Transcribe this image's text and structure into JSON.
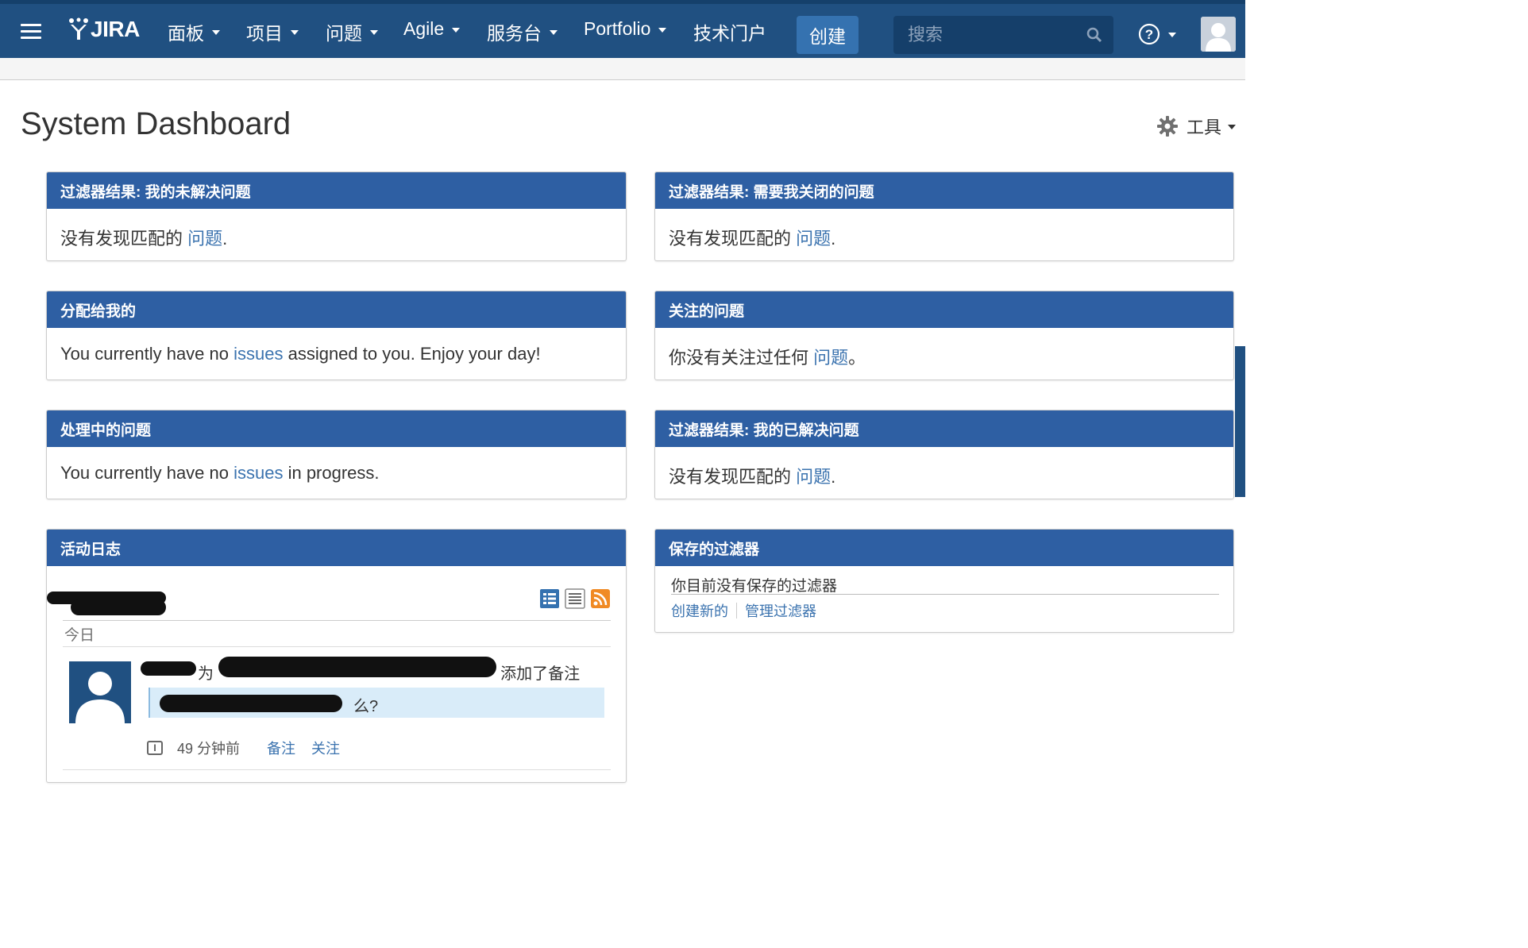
{
  "nav": {
    "logo_text": "JIRA",
    "items": [
      {
        "label": "面板"
      },
      {
        "label": "项目"
      },
      {
        "label": "问题"
      },
      {
        "label": "Agile"
      },
      {
        "label": "服务台"
      },
      {
        "label": "Portfolio"
      },
      {
        "label": "技术门户"
      }
    ],
    "create_label": "创建",
    "search_placeholder": "搜索",
    "colors": {
      "bar": "#205081",
      "create": "#3572b0",
      "search_bg": "#153f6a"
    }
  },
  "page": {
    "title": "System Dashboard",
    "tools_label": "工具"
  },
  "gadgets": {
    "unresolved": {
      "title": "过滤器结果: 我的未解决问题",
      "text": "没有发现匹配的 ",
      "link": "问题",
      "suffix": "."
    },
    "to_close": {
      "title": "过滤器结果: 需要我关闭的问题",
      "text": "没有发现匹配的 ",
      "link": "问题",
      "suffix": "."
    },
    "assigned": {
      "title": "分配给我的",
      "text": "You currently have no ",
      "link": "issues",
      "suffix": " assigned to you. Enjoy your day!"
    },
    "watched": {
      "title": "关注的问题",
      "text": "你没有关注过任何 ",
      "link": "问题",
      "suffix": "。"
    },
    "in_progress": {
      "title": "处理中的问题",
      "text": "You currently have no ",
      "link": "issues",
      "suffix": " in progress."
    },
    "resolved": {
      "title": "过滤器结果: 我的已解决问题",
      "text": "没有发现匹配的 ",
      "link": "问题",
      "suffix": "."
    },
    "activity": {
      "title": "活动日志",
      "today_label": "今日",
      "entry": {
        "verb_for": "为",
        "action": "添加了备注",
        "quote_end": "么?",
        "time": "49 分钟前",
        "comment_link": "备注",
        "watch_link": "关注"
      }
    },
    "saved_filters": {
      "title": "保存的过滤器",
      "text": "你目前没有保存的过滤器",
      "create_link": "创建新的",
      "manage_link": "管理过滤器"
    }
  },
  "accent_colors": {
    "gadget_header": "#2e5fa3",
    "link": "#3b73af",
    "quote_bg": "#d9ecf9"
  }
}
